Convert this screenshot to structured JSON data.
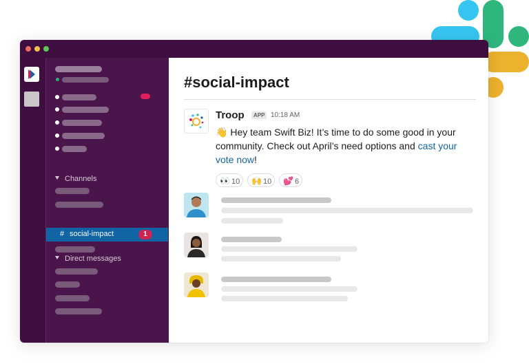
{
  "sidebar": {
    "channels_header": "Channels",
    "selected_channel": {
      "hash": "#",
      "name": "social-impact",
      "badge": "1"
    },
    "dms_header": "Direct messages"
  },
  "channel": {
    "title": "#social-impact"
  },
  "message": {
    "sender": "Troop",
    "app_tag": "APP",
    "time": "10:18 AM",
    "wave_emoji": "👋",
    "text_before_link": " Hey team Swift Biz! It’s time to do some good in your community. Check out April’s need options and ",
    "link_text": "cast your vote now",
    "text_after_link": "!"
  },
  "reactions": [
    {
      "emoji": "👀",
      "count": "10"
    },
    {
      "emoji": "🙌",
      "count": "10"
    },
    {
      "emoji": "💕",
      "count": "6"
    }
  ],
  "colors": {
    "slack_aubergine": "#3f0e40",
    "sidebar": "#4a154b",
    "selected_blue": "#1164a3",
    "badge_red": "#cd2553",
    "link_blue": "#1264a3",
    "slack_blue": "#36c5f0",
    "slack_green": "#2eb67d",
    "slack_red": "#e01e5a",
    "slack_yellow": "#ecb22e"
  }
}
